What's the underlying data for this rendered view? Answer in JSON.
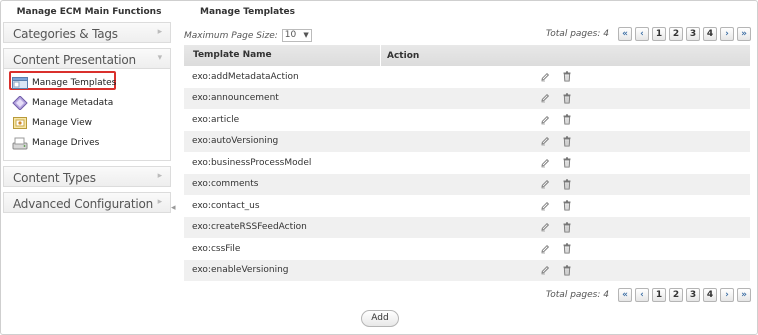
{
  "left_panel": {
    "title": "Manage ECM Main Functions",
    "sections": [
      {
        "label": "Categories & Tags"
      },
      {
        "label": "Content Presentation"
      },
      {
        "label": "Content Types"
      },
      {
        "label": "Advanced Configuration"
      }
    ],
    "items": [
      {
        "label": "Manage Templates",
        "icon": "templates-icon",
        "selected": true
      },
      {
        "label": "Manage Metadata",
        "icon": "metadata-icon"
      },
      {
        "label": "Manage View",
        "icon": "view-icon"
      },
      {
        "label": "Manage Drives",
        "icon": "drives-icon"
      }
    ]
  },
  "main": {
    "title": "Manage Templates",
    "page_size_label": "Maximum Page Size:",
    "page_size_value": "10",
    "total_pages_label": "Total pages:",
    "total_pages_value": "4",
    "pages": [
      "1",
      "2",
      "3",
      "4"
    ],
    "pager_icons": {
      "first": "«",
      "prev": "‹",
      "next": "›",
      "last": "»"
    },
    "columns": {
      "name": "Template Name",
      "action": "Action"
    },
    "rows": [
      "exo:addMetadataAction",
      "exo:announcement",
      "exo:article",
      "exo:autoVersioning",
      "exo:businessProcessModel",
      "exo:comments",
      "exo:contact_us",
      "exo:createRSSFeedAction",
      "exo:cssFile",
      "exo:enableVersioning"
    ],
    "add_label": "Add"
  },
  "colors": {
    "selection_border": "#d9302c",
    "header_bg": "#dcdcdc",
    "stripe_bg": "#f0f0f0",
    "pager_accent": "#3b6ea5"
  }
}
